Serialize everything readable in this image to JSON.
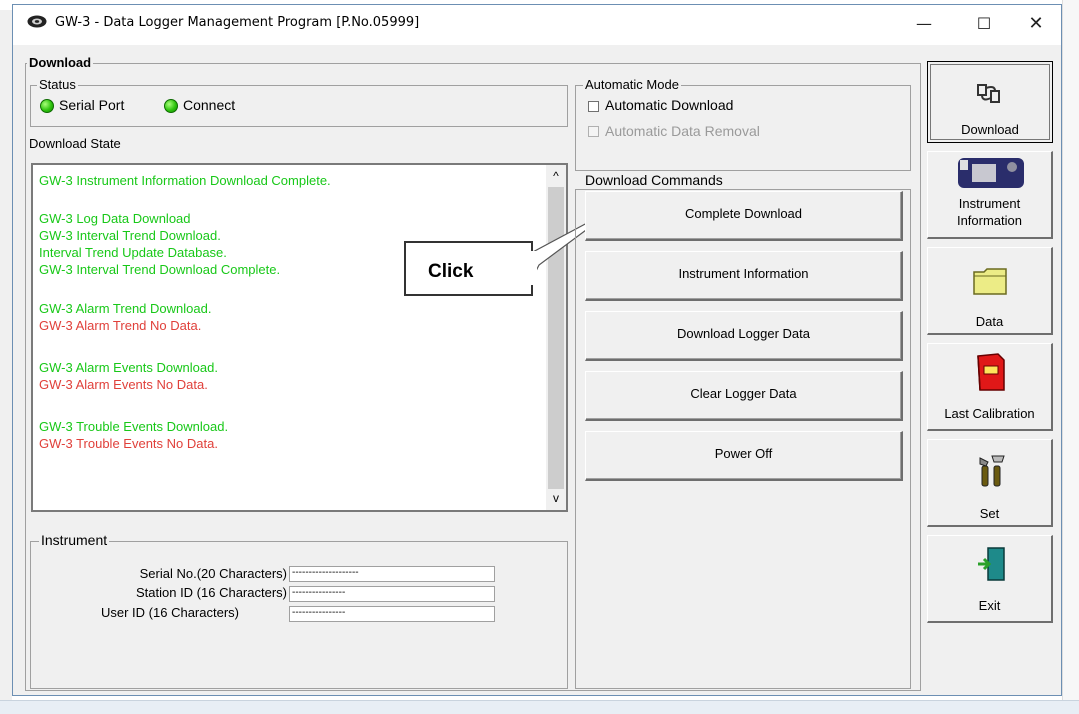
{
  "window": {
    "title": "GW-3 - Data Logger Management Program [P.No.05999]"
  },
  "controls": {
    "minimize": "—",
    "maximize": "☐",
    "close": "✕"
  },
  "download_group": {
    "label": "Download"
  },
  "status": {
    "label": "Status",
    "serial_port": "Serial Port",
    "connect": "Connect",
    "led_color": "#2fc40f"
  },
  "download_state": {
    "label": "Download State"
  },
  "log": {
    "lines": [
      {
        "text": "GW-3 Instrument Information Download Complete.",
        "color": "green"
      },
      {
        "text": "GW-3 Log Data Download",
        "color": "green"
      },
      {
        "text": "GW-3 Interval Trend Download.",
        "color": "green"
      },
      {
        "text": "Interval Trend Update Database.",
        "color": "green"
      },
      {
        "text": "GW-3 Interval Trend Download Complete.",
        "color": "green"
      },
      {
        "text": "GW-3 Alarm Trend Download.",
        "color": "green"
      },
      {
        "text": "GW-3 Alarm Trend No Data.",
        "color": "red"
      },
      {
        "text": "GW-3 Alarm Events Download.",
        "color": "green"
      },
      {
        "text": "GW-3 Alarm Events No Data.",
        "color": "red"
      },
      {
        "text": "GW-3 Trouble Events Download.",
        "color": "green"
      },
      {
        "text": "GW-3 Trouble Events No Data.",
        "color": "red"
      }
    ],
    "scroll_up": "^",
    "scroll_down": "v"
  },
  "callout": {
    "text": "Click"
  },
  "instrument": {
    "label": "Instrument",
    "serial_label": "Serial No.(20 Characters)",
    "serial_value": "--------------------",
    "station_label": "Station ID (16 Characters)",
    "station_value": "----------------",
    "user_label": "User ID (16 Characters)",
    "user_value": "----------------"
  },
  "automatic_mode": {
    "label": "Automatic Mode",
    "auto_download": "Automatic Download",
    "auto_removal": "Automatic Data Removal"
  },
  "download_commands": {
    "label": "Download Commands",
    "buttons": [
      "Complete Download",
      "Instrument Information",
      "Download Logger Data",
      "Clear Logger Data",
      "Power Off"
    ]
  },
  "sidebar": {
    "download": "Download",
    "instrument_info_1": "Instrument",
    "instrument_info_2": "Information",
    "data": "Data",
    "last_calibration": "Last Calibration",
    "set": "Set",
    "exit": "Exit"
  }
}
